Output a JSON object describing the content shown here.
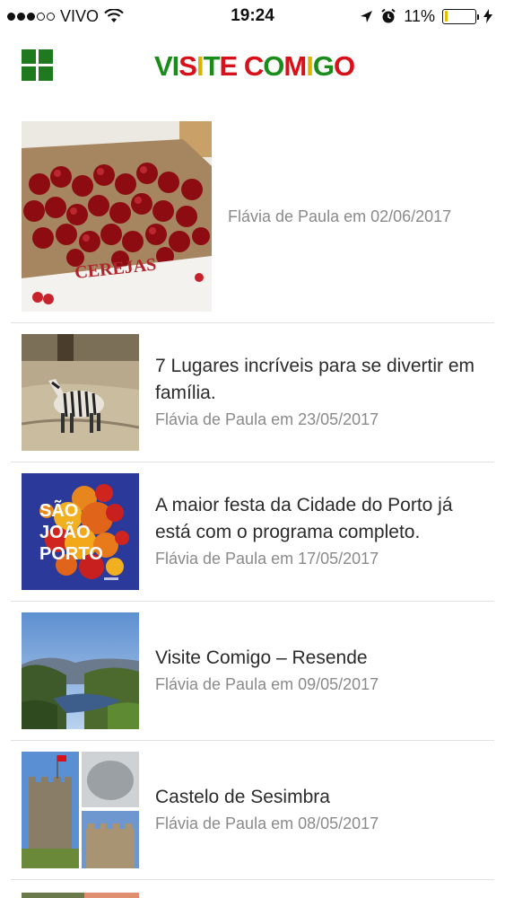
{
  "status_bar": {
    "carrier": "VIVO",
    "time": "19:24",
    "battery": "11%",
    "battery_level": 0.11
  },
  "header": {
    "logo_text": "VISITE COMIGO"
  },
  "feed": [
    {
      "title": "",
      "meta": "Flávia de Paula em 02/06/2017",
      "image": "cherries-box",
      "image_text": "CEREJAS"
    },
    {
      "title": "7 Lugares incríveis para se divertir em família.",
      "meta": "Flávia de Paula em 23/05/2017",
      "image": "zebra"
    },
    {
      "title": "A maior festa da Cidade do Porto já está com o programa completo.",
      "meta": "Flávia de Paula em 17/05/2017",
      "image": "sao-joao-poster",
      "image_text": "SÃO JOÃO PORTO"
    },
    {
      "title": "Visite Comigo – Resende",
      "meta": "Flávia de Paula em 09/05/2017",
      "image": "river-landscape"
    },
    {
      "title": "Castelo de Sesimbra",
      "meta": "Flávia de Paula em 08/05/2017",
      "image": "castle-collage"
    }
  ],
  "colors": {
    "accent_green": "#1f7a1f",
    "logo_red": "#d8101a",
    "meta_gray": "#8a8a8a"
  }
}
